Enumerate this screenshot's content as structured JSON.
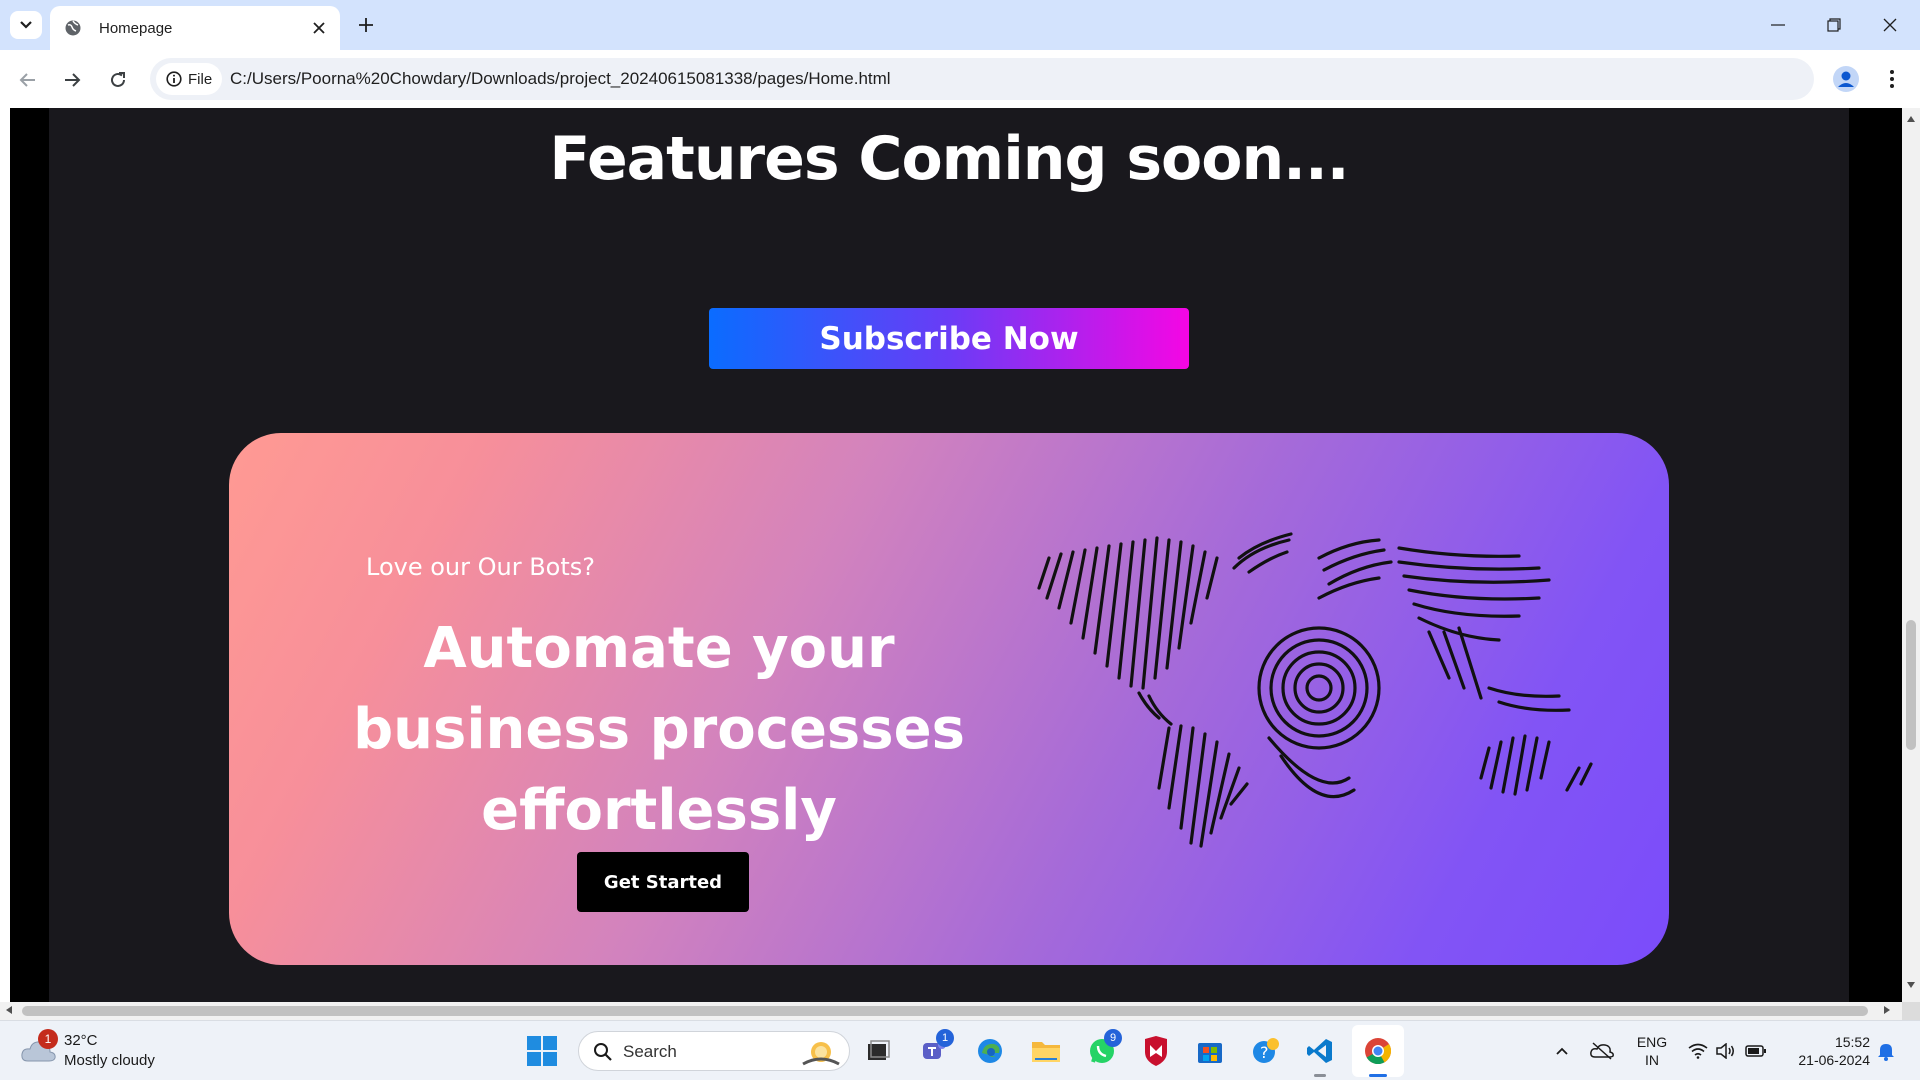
{
  "browser": {
    "tab_title": "Homepage",
    "omnibox_chip": "File",
    "url": "C:/Users/Poorna%20Chowdary/Downloads/project_20240615081338/pages/Home.html",
    "icons": [
      "tab-search-icon",
      "globe-icon",
      "close-icon",
      "plus-icon",
      "minimize-icon",
      "restore-icon",
      "close-window-icon",
      "back-icon",
      "forward-icon",
      "reload-icon",
      "info-icon",
      "star-icon",
      "profile-icon",
      "kebab-menu-icon"
    ]
  },
  "page": {
    "features_title": "Features Coming soon...",
    "subscribe_label": "Subscribe Now",
    "promo": {
      "kicker": "Love our Our Bots?",
      "heading": "Automate your business processes effortlessly",
      "cta_label": "Get Started"
    },
    "colors": {
      "page_bg": "#19181d",
      "subscribe_gradient": [
        "#0a6cff",
        "#f506e4"
      ],
      "promo_gradient": [
        "#ff9a93",
        "#7b4cfb"
      ],
      "cta_bg": "#000000"
    }
  },
  "taskbar": {
    "weather": {
      "badge": "1",
      "temp": "32°C",
      "condition": "Mostly cloudy"
    },
    "search_label": "Search",
    "apps": [
      {
        "name": "start",
        "icon": "windows-logo-icon"
      },
      {
        "name": "task-view",
        "icon": "task-view-icon"
      },
      {
        "name": "teams",
        "icon": "teams-icon",
        "badge": "1"
      },
      {
        "name": "edge",
        "icon": "edge-icon"
      },
      {
        "name": "file-explorer",
        "icon": "folder-icon"
      },
      {
        "name": "whatsapp",
        "icon": "whatsapp-icon",
        "badge": "9"
      },
      {
        "name": "mcafee",
        "icon": "mcafee-icon"
      },
      {
        "name": "store",
        "icon": "store-icon"
      },
      {
        "name": "help",
        "icon": "help-icon"
      },
      {
        "name": "vscode",
        "icon": "vscode-icon"
      },
      {
        "name": "chrome",
        "icon": "chrome-icon"
      }
    ],
    "lang_top": "ENG",
    "lang_bottom": "IN",
    "time": "15:52",
    "date": "21-06-2024"
  }
}
